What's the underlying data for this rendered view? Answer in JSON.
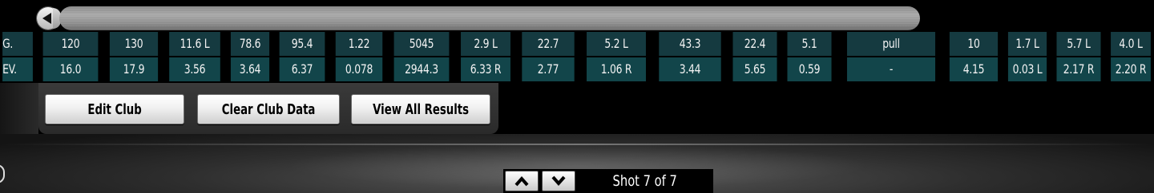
{
  "table": {
    "avg_label": "G.",
    "dev_label": "EV.",
    "columns": [
      {
        "avg": "120",
        "dev": "16.0"
      },
      {
        "avg": "130",
        "dev": "17.9"
      },
      {
        "avg": "11.6 L",
        "dev": "3.56"
      },
      {
        "avg": "78.6",
        "dev": "3.64"
      },
      {
        "avg": "95.4",
        "dev": "6.37"
      },
      {
        "avg": "1.22",
        "dev": "0.078"
      },
      {
        "avg": "5045",
        "dev": "2944.3"
      },
      {
        "avg": "2.9 L",
        "dev": "6.33 R"
      },
      {
        "avg": "22.7",
        "dev": "2.77"
      },
      {
        "avg": "5.2 L",
        "dev": "1.06 R"
      },
      {
        "avg": "43.3",
        "dev": "3.44"
      },
      {
        "avg": "22.4",
        "dev": "5.65"
      },
      {
        "avg": "5.1",
        "dev": "0.59"
      },
      {
        "avg": "pull",
        "dev": "-"
      },
      {
        "avg": "10",
        "dev": "4.15"
      },
      {
        "avg": "1.7 L",
        "dev": "0.03 L"
      },
      {
        "avg": "5.7 L",
        "dev": "2.17 R"
      },
      {
        "avg": "4.0 L",
        "dev": "2.20 R"
      }
    ]
  },
  "buttons": {
    "edit_club": "Edit Club",
    "clear_club_data": "Clear Club Data",
    "view_all_results": "View All Results"
  },
  "shot_nav": {
    "counter": "Shot 7 of 7",
    "prev_icon": "chevron-up-icon",
    "next_icon": "chevron-down-icon"
  },
  "colors": {
    "table_row": "#153a40",
    "background": "#000000",
    "button_face": "#f1f1f1"
  }
}
